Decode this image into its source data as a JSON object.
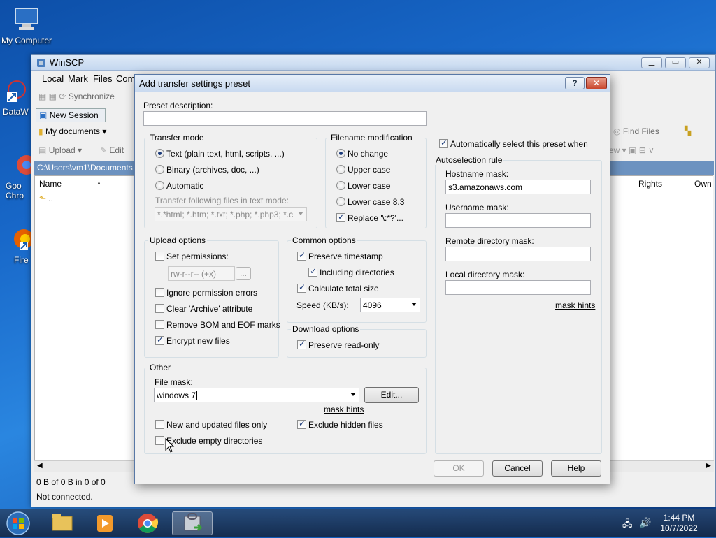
{
  "desktop": {
    "icons": [
      {
        "label": "My Computer"
      },
      {
        "label": "DataW"
      },
      {
        "label": "Goo Chro"
      },
      {
        "label": "Fire"
      }
    ]
  },
  "main_window": {
    "title": "WinSCP",
    "menu": [
      "Local",
      "Mark",
      "Files",
      "Com"
    ],
    "toolbar_synchronize": "Synchronize",
    "new_session_tab": "New Session",
    "location": "My documents",
    "upload": "Upload",
    "edit": "Edit",
    "path": "C:\\Users\\vm1\\Documents",
    "col_name": "Name",
    "parent_dir": "..",
    "find_files": "Find Files",
    "right_col_rights": "Rights",
    "right_col_owner": "Own",
    "right_toolbar_new": "ew",
    "status_bytes": "0 B of 0 B in 0 of 0",
    "status_connection": "Not connected."
  },
  "dialog": {
    "title": "Add transfer settings preset",
    "help_glyph": "?",
    "close_glyph": "✕",
    "preset_description_label": "Preset description:",
    "preset_description_value": "",
    "transfer_mode": {
      "title": "Transfer mode",
      "text_label": "Text (plain text, html, scripts, ...)",
      "binary_label": "Binary (archives, doc, ...)",
      "automatic_label": "Automatic",
      "selected": "text",
      "text_mode_files_label": "Transfer following files in text mode:",
      "text_mode_files_value": "*.*html; *.htm; *.txt; *.php; *.php3; *.c"
    },
    "filename_modification": {
      "title": "Filename modification",
      "no_change": "No change",
      "upper_case": "Upper case",
      "lower_case": "Lower case",
      "lower_case_83": "Lower case 8.3",
      "selected": "no_change",
      "replace_label": "Replace '\\:*?'...",
      "replace_checked": true
    },
    "upload_options": {
      "title": "Upload options",
      "set_permissions": "Set permissions:",
      "set_permissions_checked": false,
      "permissions_value": "rw-r--r-- (+x)",
      "permissions_button": "...",
      "ignore_permission_errors": "Ignore permission errors",
      "clear_archive": "Clear 'Archive' attribute",
      "remove_bom": "Remove BOM and EOF marks",
      "encrypt_new_files": "Encrypt new files",
      "encrypt_checked": true
    },
    "common_options": {
      "title": "Common options",
      "preserve_timestamp": "Preserve timestamp",
      "preserve_timestamp_checked": true,
      "including_directories": "Including directories",
      "including_directories_checked": true,
      "calculate_total_size": "Calculate total size",
      "calculate_total_size_checked": true,
      "speed_label": "Speed (KB/s):",
      "speed_value": "4096"
    },
    "download_options": {
      "title": "Download options",
      "preserve_read_only": "Preserve read-only",
      "preserve_read_only_checked": true
    },
    "other": {
      "title": "Other",
      "file_mask_label": "File mask:",
      "file_mask_value": "windows 7",
      "edit_button": "Edit...",
      "mask_hints": "mask hints",
      "new_and_updated": "New and updated files only",
      "exclude_hidden": "Exclude hidden files",
      "exclude_hidden_checked": true,
      "exclude_empty_dirs": "Exclude empty directories"
    },
    "autoselect": {
      "checkbox_label": "Automatically select this preset when",
      "checked": true,
      "rule_title": "Autoselection rule",
      "hostname_label": "Hostname mask:",
      "hostname_value": "s3.amazonaws.com",
      "username_label": "Username mask:",
      "username_value": "",
      "remote_dir_label": "Remote directory mask:",
      "remote_dir_value": "",
      "local_dir_label": "Local directory mask:",
      "local_dir_value": "",
      "mask_hints": "mask hints"
    },
    "buttons": {
      "ok": "OK",
      "cancel": "Cancel",
      "help": "Help"
    }
  },
  "taskbar": {
    "time": "1:44 PM",
    "date": "10/7/2022"
  }
}
